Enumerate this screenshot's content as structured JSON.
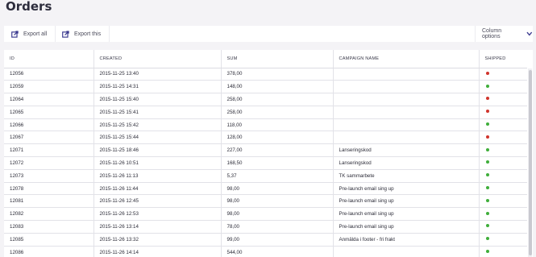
{
  "page": {
    "title": "Orders"
  },
  "toolbar": {
    "export_all_label": "Export all",
    "export_this_label": "Export this",
    "column_options_label": "Column options",
    "export_icon": "export-icon",
    "chevron_icon": "chevron-down-icon",
    "accent_color": "#3b3a8f"
  },
  "table": {
    "columns": [
      "ID",
      "CREATED",
      "SUM",
      "CAMPAIGN NAME",
      "SHIPPED"
    ],
    "status_colors": {
      "shipped": "#3fae3a",
      "not_shipped": "#d0342c"
    },
    "rows": [
      {
        "id": "12056",
        "created": "2015-11-25 13:40",
        "sum": "378,00",
        "campaign": "",
        "shipped": false
      },
      {
        "id": "12059",
        "created": "2015-11-25 14:31",
        "sum": "148,00",
        "campaign": "",
        "shipped": true
      },
      {
        "id": "12064",
        "created": "2015-11-25 15:40",
        "sum": "258,00",
        "campaign": "",
        "shipped": false
      },
      {
        "id": "12065",
        "created": "2015-11-25 15:41",
        "sum": "258,00",
        "campaign": "",
        "shipped": false
      },
      {
        "id": "12066",
        "created": "2015-11-25 15:42",
        "sum": "118,00",
        "campaign": "",
        "shipped": true
      },
      {
        "id": "12067",
        "created": "2015-11-25 15:44",
        "sum": "128,00",
        "campaign": "",
        "shipped": false
      },
      {
        "id": "12071",
        "created": "2015-11-25 18:46",
        "sum": "227,00",
        "campaign": "Lanseringskod",
        "shipped": true
      },
      {
        "id": "12072",
        "created": "2015-11-26 10:51",
        "sum": "168,50",
        "campaign": "Lanseringskod",
        "shipped": true
      },
      {
        "id": "12073",
        "created": "2015-11-26 11:13",
        "sum": "5,37",
        "campaign": "TK sammarbete",
        "shipped": true
      },
      {
        "id": "12078",
        "created": "2015-11-26 11:44",
        "sum": "98,00",
        "campaign": "Pre-launch email sing up",
        "shipped": true
      },
      {
        "id": "12081",
        "created": "2015-11-26 12:45",
        "sum": "98,00",
        "campaign": "Pre-launch email sing up",
        "shipped": true
      },
      {
        "id": "12082",
        "created": "2015-11-26 12:53",
        "sum": "98,00",
        "campaign": "Pre-launch email sing up",
        "shipped": true
      },
      {
        "id": "12083",
        "created": "2015-11-26 13:14",
        "sum": "78,00",
        "campaign": "Pre-launch email sing up",
        "shipped": true
      },
      {
        "id": "12085",
        "created": "2015-11-26 13:32",
        "sum": "99,00",
        "campaign": "Anmälda i footer - fri frakt",
        "shipped": true
      },
      {
        "id": "12086",
        "created": "2015-11-26 14:14",
        "sum": "544,00",
        "campaign": "",
        "shipped": true
      }
    ]
  }
}
